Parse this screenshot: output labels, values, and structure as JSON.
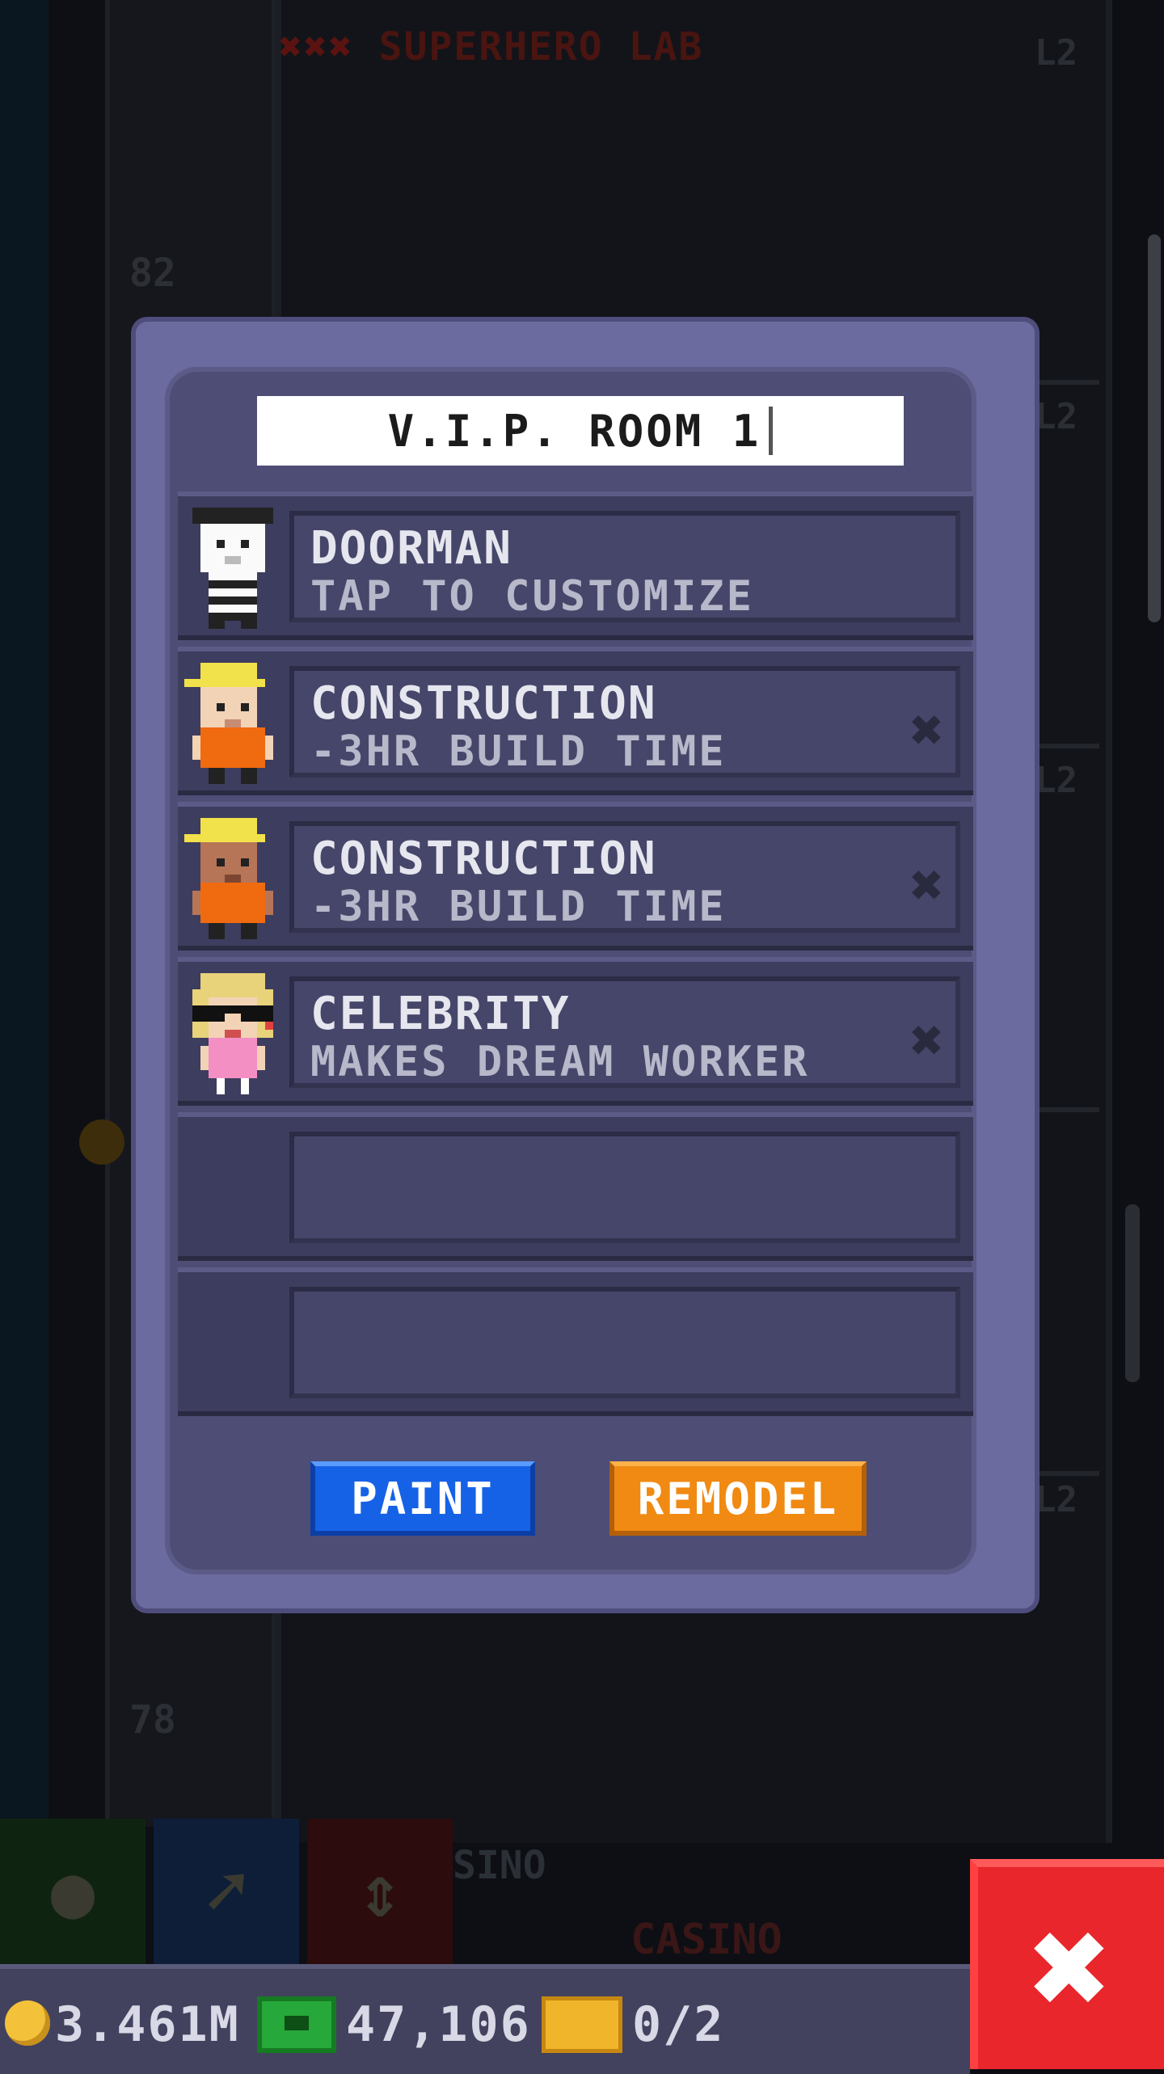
{
  "background": {
    "lab_title": "SUPERHERO LAB",
    "lab_marks": "✖✖✖",
    "floor_numbers": [
      "82",
      "78"
    ],
    "level_tags": [
      "L2",
      "L2",
      "L2",
      "L2"
    ],
    "casino_label": "SINO",
    "casino_sign": "CASINO"
  },
  "dialog": {
    "room_name": "V.I.P. ROOM 1",
    "rows": [
      {
        "title": "DOORMAN",
        "subtitle": "TAP TO CUSTOMIZE",
        "avatar": "mime-icon",
        "removable": false
      },
      {
        "title": "CONSTRUCTION",
        "subtitle": "-3HR BUILD TIME",
        "avatar": "construction-worker-icon",
        "removable": true
      },
      {
        "title": "CONSTRUCTION",
        "subtitle": "-3HR BUILD TIME",
        "avatar": "construction-worker-icon",
        "removable": true
      },
      {
        "title": "CELEBRITY",
        "subtitle": "MAKES DREAM WORKER",
        "avatar": "celebrity-icon",
        "removable": true
      },
      {
        "title": "",
        "subtitle": "",
        "avatar": "",
        "removable": false
      },
      {
        "title": "",
        "subtitle": "",
        "avatar": "",
        "removable": false
      }
    ],
    "remove_glyph": "✖",
    "paint_label": "PAINT",
    "remodel_label": "REMODEL"
  },
  "statusbar": {
    "coins": "3.461M",
    "bux": "47,106",
    "tickets": "0/2"
  },
  "close_glyph": "✖",
  "colors": {
    "paint": "#1662e6",
    "remodel": "#f08a12",
    "close": "#e8262b",
    "panel": "#4d4d75"
  }
}
